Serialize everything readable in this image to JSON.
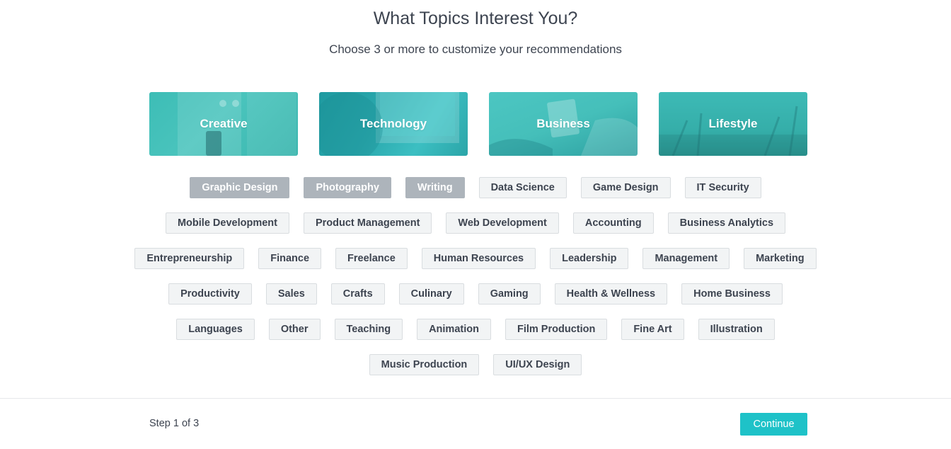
{
  "header": {
    "title": "What Topics Interest You?",
    "subtitle": "Choose 3 or more to customize your recommendations"
  },
  "categories": [
    {
      "label": "Creative"
    },
    {
      "label": "Technology"
    },
    {
      "label": "Business"
    },
    {
      "label": "Lifestyle"
    }
  ],
  "tag_rows": [
    [
      {
        "label": "Graphic Design",
        "selected": true
      },
      {
        "label": "Photography",
        "selected": true
      },
      {
        "label": "Writing",
        "selected": true
      },
      {
        "label": "Data Science",
        "selected": false
      },
      {
        "label": "Game Design",
        "selected": false
      },
      {
        "label": "IT Security",
        "selected": false
      }
    ],
    [
      {
        "label": "Mobile Development",
        "selected": false
      },
      {
        "label": "Product Management",
        "selected": false
      },
      {
        "label": "Web Development",
        "selected": false
      },
      {
        "label": "Accounting",
        "selected": false
      },
      {
        "label": "Business Analytics",
        "selected": false
      }
    ],
    [
      {
        "label": "Entrepreneurship",
        "selected": false
      },
      {
        "label": "Finance",
        "selected": false
      },
      {
        "label": "Freelance",
        "selected": false
      },
      {
        "label": "Human Resources",
        "selected": false
      },
      {
        "label": "Leadership",
        "selected": false
      },
      {
        "label": "Management",
        "selected": false
      },
      {
        "label": "Marketing",
        "selected": false
      }
    ],
    [
      {
        "label": "Productivity",
        "selected": false
      },
      {
        "label": "Sales",
        "selected": false
      },
      {
        "label": "Crafts",
        "selected": false
      },
      {
        "label": "Culinary",
        "selected": false
      },
      {
        "label": "Gaming",
        "selected": false
      },
      {
        "label": "Health & Wellness",
        "selected": false
      },
      {
        "label": "Home Business",
        "selected": false
      }
    ],
    [
      {
        "label": "Languages",
        "selected": false
      },
      {
        "label": "Other",
        "selected": false
      },
      {
        "label": "Teaching",
        "selected": false
      },
      {
        "label": "Animation",
        "selected": false
      },
      {
        "label": "Film Production",
        "selected": false
      },
      {
        "label": "Fine Art",
        "selected": false
      },
      {
        "label": "Illustration",
        "selected": false
      }
    ],
    [
      {
        "label": "Music Production",
        "selected": false
      },
      {
        "label": "UI/UX Design",
        "selected": false
      }
    ]
  ],
  "footer": {
    "step_text": "Step 1 of 3",
    "continue_label": "Continue"
  },
  "colors": {
    "accent": "#1ec2c8",
    "tag_selected_bg": "#adb4bb",
    "tag_bg": "#f2f4f5",
    "text": "#3d4450",
    "category_teal": "#3dbdb6"
  }
}
